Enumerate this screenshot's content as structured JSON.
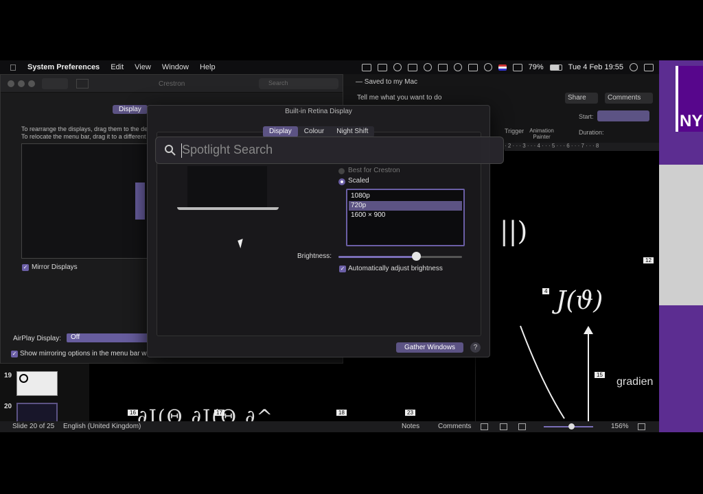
{
  "menubar": {
    "app": "System Preferences",
    "items": [
      "Edit",
      "View",
      "Window",
      "Help"
    ],
    "battery": "79%",
    "clock": "Tue 4 Feb  19:55"
  },
  "sysprefs": {
    "title": "Crestron",
    "search_placeholder": "Search",
    "tab": "Display",
    "info1": "To rearrange the displays, drag them to the de",
    "info2": "To relocate the menu bar, drag it to a different",
    "mirror": "Mirror Displays",
    "airplay_label": "AirPlay Display:",
    "airplay_value": "Off",
    "show_mirroring": "Show mirroring options in the menu bar w"
  },
  "powerpoint": {
    "saved": "— Saved to my Mac",
    "tellme": "Tell me what you want to do",
    "share": "Share",
    "comments": "Comments",
    "trigger": "Trigger",
    "animation_painter": "Animation Painter",
    "start": "Start:",
    "duration": "Duration:",
    "ruler": "· 2 · · · 3 · · · 4 · · · 5 · · · 6 · · · 7 · · · 8",
    "math1": "; ||)",
    "math2": "J(ϑ)",
    "gradient": "gradien",
    "tags": {
      "t4": "4",
      "t12": "12",
      "t15": "15",
      "b16": "16",
      "b17": "17",
      "b18": "18",
      "b23": "23"
    },
    "bottom_math": "∂J(Θ   ∂J(Θ   ∂^",
    "nyu": "NY",
    "slide_numbers": [
      "19",
      "20"
    ]
  },
  "statusbar": {
    "slide": "Slide 20 of 25",
    "language": "English (United Kingdom)",
    "notes": "Notes",
    "comments": "Comments",
    "zoom": "156%",
    "zoom_level": 0.55
  },
  "display_window": {
    "title": "Built-in Retina Display",
    "tabs": [
      "Display",
      "Colour",
      "Night Shift"
    ],
    "best_for": "Best for Crestron",
    "scaled": "Scaled",
    "resolutions": [
      "1080p",
      "720p",
      "1600 × 900"
    ],
    "selected_resolution": "720p",
    "brightness_label": "Brightness:",
    "brightness_level": 0.63,
    "auto_brightness": "Automatically adjust brightness",
    "gather_windows": "Gather Windows",
    "help": "?"
  },
  "spotlight": {
    "placeholder": "Spotlight Search"
  },
  "colors": {
    "accent": "#5c5384",
    "nyu_purple": "#57068c"
  }
}
